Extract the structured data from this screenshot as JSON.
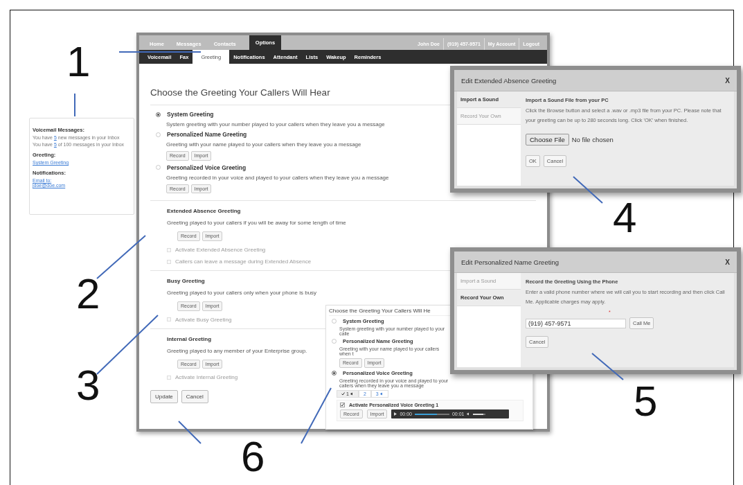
{
  "callouts": [
    {
      "label": "1"
    },
    {
      "label": "2"
    },
    {
      "label": "3"
    },
    {
      "label": "4"
    },
    {
      "label": "5"
    },
    {
      "label": "6"
    }
  ],
  "summary_card": {
    "voicemail_title": "Voicemail Messages:",
    "messages": [
      {
        "before": "You have ",
        "link": "5",
        "after": " new messages in your Inbox"
      },
      {
        "before": "You have ",
        "link": "5",
        "after": " of 100 messages in your Inbox"
      }
    ],
    "greeting_title": "Greeting:",
    "greeting_link": "System Greeting",
    "notifications_title": "Notifications:",
    "notification_links": [
      "Email to:",
      "jdoe@doe.com"
    ]
  },
  "main_window": {
    "top_nav": [
      {
        "label": "Home",
        "selected": false
      },
      {
        "label": "Messages",
        "selected": false
      },
      {
        "label": "Contacts",
        "selected": false
      },
      {
        "label": "Options",
        "selected": true
      }
    ],
    "account_items": [
      "John Doe",
      "(919) 457-9571",
      "My Account",
      "Logout"
    ],
    "sub_nav": [
      {
        "label": "Voicemail",
        "selected": false
      },
      {
        "label": "Fax",
        "selected": false
      },
      {
        "label": "Greeting",
        "selected": true
      },
      {
        "label": "Notifications",
        "selected": false
      },
      {
        "label": "Attendant",
        "selected": false
      },
      {
        "label": "Lists",
        "selected": false
      },
      {
        "label": "Wakeup",
        "selected": false
      },
      {
        "label": "Reminders",
        "selected": false
      }
    ],
    "heading": "Choose the Greeting Your Callers Will Hear",
    "greetings": [
      {
        "title": "System Greeting",
        "description": "System greeting with your number played to your callers when they leave you a message",
        "selected": true
      },
      {
        "title": "Personalized Name Greeting",
        "description": "Greeting with your name played to your callers when they leave you a message",
        "selected": false,
        "buttons": [
          "Record",
          "Import"
        ]
      },
      {
        "title": "Personalized Voice Greeting",
        "description": "Greeting recorded in your voice and played to your callers when they leave you a message",
        "selected": false,
        "buttons": [
          "Record",
          "Import"
        ]
      }
    ],
    "sections": [
      {
        "title": "Extended Absence Greeting",
        "description": "Greeting played to your callers if you will be away for some length of time",
        "buttons": [
          "Record",
          "Import"
        ],
        "options": [
          {
            "label": "Activate Extended Absence Greeting",
            "checked": false,
            "disabled": true
          },
          {
            "label": "Callers can leave a message during Extended Absence",
            "checked": false,
            "disabled": true
          }
        ]
      },
      {
        "title": "Busy Greeting",
        "description": "Greeting played to your callers only when your phone is busy",
        "buttons": [
          "Record",
          "Import"
        ],
        "options": [
          {
            "label": "Activate Busy Greeting",
            "checked": false,
            "disabled": true
          }
        ]
      },
      {
        "title": "Internal Greeting",
        "description": "Greeting played to any member of your Enterprise group.",
        "buttons": [
          "Record",
          "Import"
        ],
        "options": [
          {
            "label": "Activate Internal Greeting",
            "checked": false,
            "disabled": true
          }
        ]
      }
    ],
    "actions": [
      "Update",
      "Cancel"
    ]
  },
  "inset": {
    "title": "Choose the Greeting Your Callers Will He",
    "greetings": [
      {
        "title": "System Greeting",
        "description": "System greeting with your number played to your calle",
        "selected": false
      },
      {
        "title": "Personalized Name Greeting",
        "description": "Greeting with your name played to your callers when t",
        "selected": false,
        "buttons": [
          "Record",
          "Import"
        ]
      },
      {
        "title": "Personalized Voice Greeting",
        "description": "Greeting recorded in your voice and played to your callers when they leave you a message",
        "selected": true
      }
    ],
    "tabs": [
      {
        "label": "1",
        "selected": true,
        "recorded": true,
        "audio": true
      },
      {
        "label": "2",
        "selected": false,
        "recorded": false,
        "audio": false
      },
      {
        "label": "3",
        "selected": false,
        "recorded": false,
        "audio": true
      }
    ],
    "activate": {
      "label": "Activate Personalized Voice Greeting 1",
      "checked": true
    },
    "buttons": [
      "Record",
      "Import"
    ],
    "player": {
      "elapsed": "00:00",
      "duration": "00:01",
      "progress": {
        "level": 0.65
      },
      "volume": {
        "level": 0.8
      }
    }
  },
  "dialogs": [
    {
      "kind": "file",
      "title": "Edit Extended Absence Greeting",
      "close": "X",
      "tabs": [
        {
          "label": "Import a Sound",
          "selected": true
        },
        {
          "label": "Record Your Own",
          "selected": false
        }
      ],
      "heading": "Import a Sound File from your PC",
      "body": "Click the Browse button and select a .wav or .mp3 file from your PC. Please note that your greeting can be up to 280 seconds long. Click 'OK' when finished.",
      "file_button": "Choose File",
      "file_status": "No file chosen",
      "buttons": [
        "OK",
        "Cancel"
      ]
    },
    {
      "kind": "phone",
      "title": "Edit Personalized Name Greeting",
      "close": "X",
      "tabs": [
        {
          "label": "Import a Sound",
          "selected": false
        },
        {
          "label": "Record Your Own",
          "selected": true
        }
      ],
      "heading": "Record the Greeting Using the Phone",
      "body": "Enter a valid phone number where we will call you to start recording and then click Call Me. Applicable charges may apply.",
      "required_mark": "*",
      "phone": "(919) 457-9571",
      "call_button": "Call Me",
      "buttons": [
        "Cancel"
      ]
    }
  ]
}
